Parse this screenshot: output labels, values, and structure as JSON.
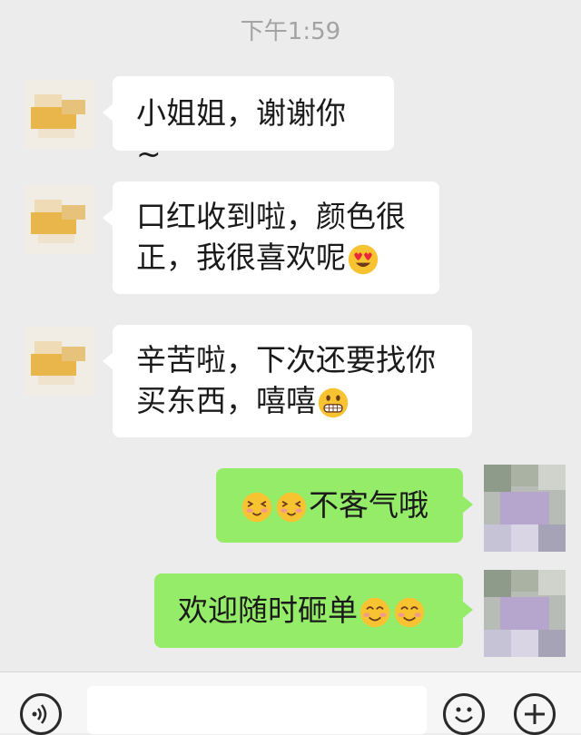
{
  "chat": {
    "timestamp": "下午1:59",
    "messages": [
      {
        "sender": "other",
        "lines": [
          "小姐姐，谢谢你~"
        ],
        "emoji_after": []
      },
      {
        "sender": "other",
        "lines": [
          "口红收到啦，颜色很",
          "正，我很喜欢呢"
        ],
        "emoji_after": [
          "heart-eyes"
        ]
      },
      {
        "sender": "other",
        "lines": [
          "辛苦啦，下次还要找你",
          "买东西，嘻嘻"
        ],
        "emoji_after": [
          "grimace"
        ]
      },
      {
        "sender": "self",
        "lines": [
          "不客气哦"
        ],
        "emoji_before": [
          "shy-face",
          "shy-face"
        ]
      },
      {
        "sender": "self",
        "lines": [
          "欢迎随时砸单"
        ],
        "emoji_after": [
          "smile",
          "smile"
        ]
      }
    ]
  },
  "input_bar": {
    "text_value": "",
    "icons": [
      "voice-icon",
      "emoji-icon",
      "plus-icon"
    ]
  },
  "colors": {
    "background": "#ececec",
    "incoming_bubble": "#ffffff",
    "outgoing_bubble": "#95ec69",
    "timestamp": "#a3a3a3"
  }
}
